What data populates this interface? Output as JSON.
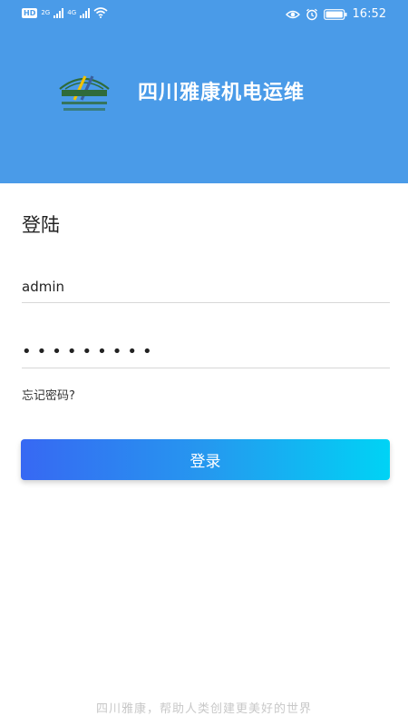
{
  "statusbar": {
    "hd_label": "HD",
    "net1_label": "2G",
    "net2_label": "4G",
    "time": "16:52",
    "icons": [
      "hd-icon",
      "signal-icon",
      "wifi-icon",
      "eye-icon",
      "alarm-icon",
      "battery-icon"
    ]
  },
  "header": {
    "title": "四川雅康机电运维",
    "logo_icon": "company-logo",
    "background_color": "#4a9be8"
  },
  "login": {
    "heading": "登陆",
    "username_value": "admin",
    "password_value": "•••••••••",
    "forgot_label": "忘记密码?",
    "submit_label": "登录"
  },
  "footer": {
    "slogan": "四川雅康，帮助人类创建更美好的世界"
  },
  "colors": {
    "accent": "#4a9be8",
    "button_gradient_start": "#3768f3",
    "button_gradient_end": "#00d3f5"
  }
}
